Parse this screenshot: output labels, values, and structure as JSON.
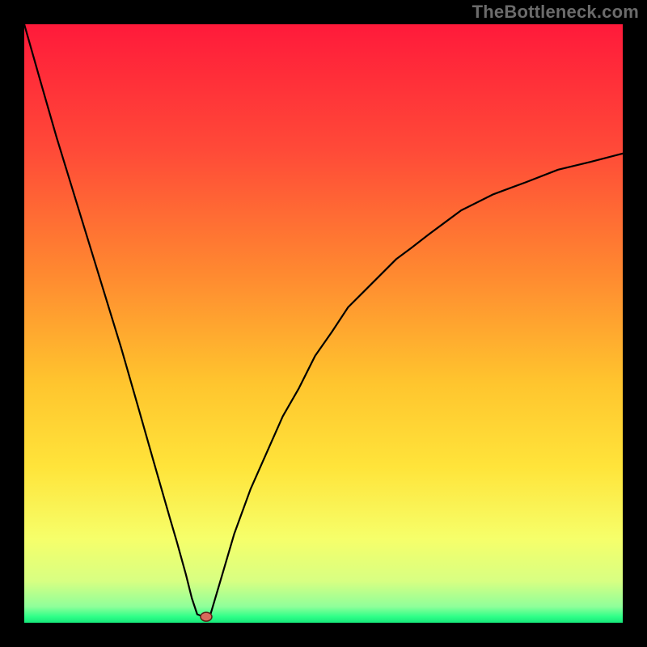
{
  "watermark": "TheBottleneck.com",
  "colors": {
    "frame": "#000000",
    "watermark": "#6b6b6b",
    "curve": "#000000",
    "dot_fill": "#d86a5c",
    "dot_stroke": "#5a1f17",
    "gradient_stops": [
      {
        "offset": 0.0,
        "color": "#ff1a3a"
      },
      {
        "offset": 0.21,
        "color": "#ff4a38"
      },
      {
        "offset": 0.42,
        "color": "#ff8a30"
      },
      {
        "offset": 0.6,
        "color": "#ffc52e"
      },
      {
        "offset": 0.74,
        "color": "#ffe43a"
      },
      {
        "offset": 0.86,
        "color": "#f6ff6a"
      },
      {
        "offset": 0.93,
        "color": "#d8ff82"
      },
      {
        "offset": 0.973,
        "color": "#8fff9a"
      },
      {
        "offset": 0.99,
        "color": "#2eff88"
      },
      {
        "offset": 1.0,
        "color": "#16e77a"
      }
    ]
  },
  "chart_data": {
    "type": "line",
    "title": "",
    "xlabel": "",
    "ylabel": "",
    "xlim": [
      0,
      100
    ],
    "ylim": [
      0,
      100
    ],
    "categories_note": "x axis is 0–100 left-to-right; y axis is 0 (bottom/green) to 100 (top/red); bottleneck minimum reaches ~0 around x≈30",
    "x": [
      0,
      2.7,
      5.4,
      8.1,
      10.8,
      13.5,
      16.2,
      18.9,
      21.6,
      24.3,
      25.5,
      27.0,
      28.0,
      28.9,
      30.0,
      31.0,
      33.1,
      35.1,
      37.8,
      40.5,
      43.2,
      45.9,
      48.6,
      51.4,
      54.1,
      56.8,
      59.5,
      62.2,
      64.9,
      67.6,
      70.3,
      73.0,
      78.4,
      83.8,
      89.2,
      94.6,
      100.0
    ],
    "y": [
      100.0,
      90.5,
      81.1,
      72.3,
      63.5,
      54.7,
      45.9,
      36.5,
      27.0,
      17.6,
      13.5,
      8.1,
      4.1,
      1.4,
      1.0,
      1.0,
      8.1,
      14.9,
      22.3,
      28.4,
      34.5,
      39.2,
      44.6,
      48.6,
      52.7,
      55.4,
      58.1,
      60.8,
      62.8,
      64.9,
      66.9,
      68.9,
      71.6,
      73.6,
      75.7,
      77.0,
      78.4
    ],
    "marker_point": {
      "x": 30.4,
      "y": 1.0
    }
  }
}
